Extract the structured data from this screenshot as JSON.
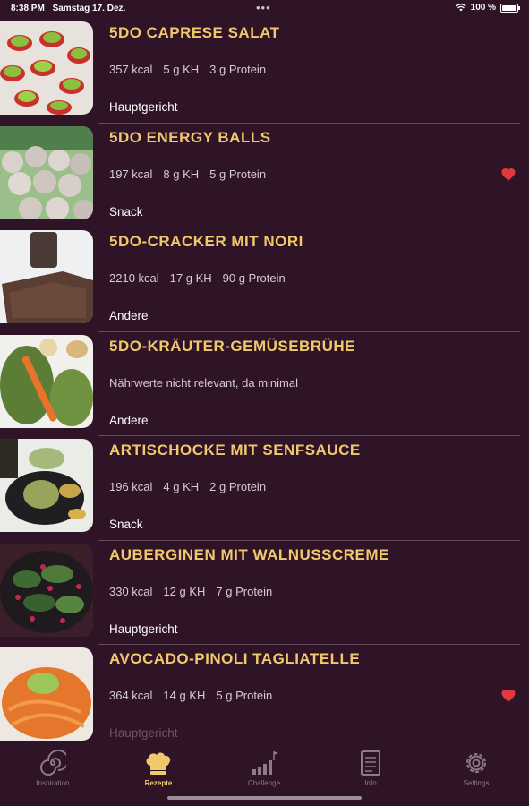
{
  "status_bar": {
    "time": "8:38 PM",
    "date": "Samstag 17. Dez.",
    "dots": "•••",
    "battery": "100 %"
  },
  "recipes": [
    {
      "title": "5DO CAPRESE SALAT",
      "kcal": "357 kcal",
      "carbs": "5 g KH",
      "protein": "3 g Protein",
      "note": "",
      "category": "Hauptgericht",
      "favorite": false
    },
    {
      "title": "5DO ENERGY BALLS",
      "kcal": "197 kcal",
      "carbs": "8 g KH",
      "protein": "5 g Protein",
      "note": "",
      "category": "Snack",
      "favorite": true
    },
    {
      "title": "5DO-CRACKER MIT NORI",
      "kcal": "2210 kcal",
      "carbs": "17 g KH",
      "protein": "90 g Protein",
      "note": "",
      "category": "Andere",
      "favorite": false
    },
    {
      "title": "5DO-KRÄUTER-GEMÜSEBRÜHE",
      "kcal": "",
      "carbs": "",
      "protein": "",
      "note": "Nährwerte nicht relevant, da minimal",
      "category": "Andere",
      "favorite": false
    },
    {
      "title": "ARTISCHOCKE MIT SENFSAUCE",
      "kcal": "196 kcal",
      "carbs": "4 g KH",
      "protein": "2 g Protein",
      "note": "",
      "category": "Snack",
      "favorite": false
    },
    {
      "title": "AUBERGINEN MIT WALNUSSCREME",
      "kcal": "330 kcal",
      "carbs": "12 g KH",
      "protein": "7 g Protein",
      "note": "",
      "category": "Hauptgericht",
      "favorite": false
    },
    {
      "title": "AVOCADO-PINOLI TAGLIATELLE",
      "kcal": "364 kcal",
      "carbs": "14 g KH",
      "protein": "5 g Protein",
      "note": "",
      "category": "Hauptgericht",
      "favorite": true
    }
  ],
  "tabs": [
    {
      "label": "Inspiration",
      "icon": "spiral-icon",
      "active": false
    },
    {
      "label": "Rezepte",
      "icon": "chef-hat-icon",
      "active": true
    },
    {
      "label": "Challenge",
      "icon": "bar-flag-icon",
      "active": false
    },
    {
      "label": "Info",
      "icon": "document-icon",
      "active": false
    },
    {
      "label": "Settings",
      "icon": "gear-icon",
      "active": false
    }
  ],
  "colors": {
    "background": "#2f1327",
    "title": "#f1c86b",
    "heart": "#e0393e",
    "divider": "#6a4a5e"
  }
}
